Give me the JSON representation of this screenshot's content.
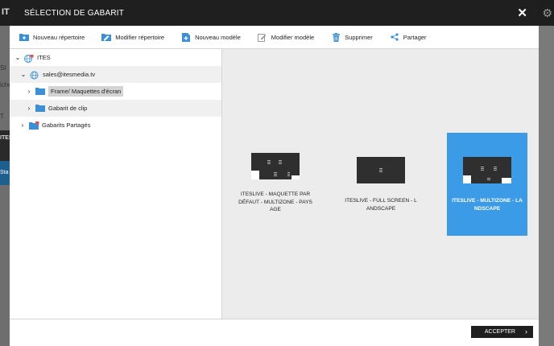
{
  "background": {
    "app_logo": "ITE",
    "gear_icon": "gear-icon",
    "fragments": [
      "SI",
      "iche",
      "T",
      "ITES",
      "Sta"
    ]
  },
  "modal": {
    "title": "SÉLECTION DE GABARIT",
    "close_icon": "close-icon",
    "toolbar": [
      {
        "label": "Nouveau répertoire",
        "icon": "new-folder-icon"
      },
      {
        "label": "Modifier répertoire",
        "icon": "edit-folder-icon"
      },
      {
        "label": "Nouveau modèle",
        "icon": "new-template-icon"
      },
      {
        "label": "Modifier modèle",
        "icon": "edit-template-icon"
      },
      {
        "label": "Supprimer",
        "icon": "trash-icon"
      },
      {
        "label": "Partager",
        "icon": "share-icon"
      }
    ],
    "tree": [
      {
        "label": "ITES",
        "icon": "globe-lock-icon",
        "expanded": true
      },
      {
        "label": "sales@itesmedia.tv",
        "icon": "globe-icon",
        "expanded": true
      },
      {
        "label": "Frame/ Maquettes d'écran",
        "icon": "folder-icon",
        "selected": true
      },
      {
        "label": "Gabarit de clip",
        "icon": "folder-icon"
      },
      {
        "label": "Gabarits Partagés",
        "icon": "shared-folder-icon"
      }
    ],
    "templates": [
      {
        "name": "ITESLIVE - MAQUETTE PAR DÉFAUT - MULTIZONE - PAYSAGE",
        "layout": "multizone-default",
        "selected": false
      },
      {
        "name": "ITESLIVE - FULL SCREEN - LANDSCAPE",
        "layout": "fullscreen",
        "selected": false
      },
      {
        "name": "ITESLIVE - MULTIZONE - LANDSCAPE",
        "layout": "multizone",
        "selected": true
      }
    ],
    "accept_label": "ACCEPTER"
  },
  "colors": {
    "header": "#1f1f1f",
    "accent": "#3b9be6",
    "icon_blue": "#3a8fd6",
    "lock_red": "#d9534f"
  }
}
